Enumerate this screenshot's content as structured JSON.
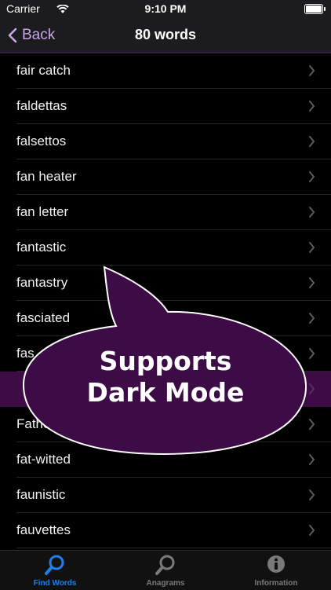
{
  "status": {
    "carrier": "Carrier",
    "time": "9:10 PM"
  },
  "nav": {
    "back_label": "Back",
    "title": "80 words"
  },
  "words": [
    "fair catch",
    "faldettas",
    "falsettos",
    "fan heater",
    "fan letter",
    "fantastic",
    "fantastry",
    "fasciated",
    "fas",
    "",
    "Father",
    "fat-witted",
    "faunistic",
    "fauvettes"
  ],
  "selected_index": 9,
  "overlay": {
    "line1": "Supports",
    "line2": "Dark Mode"
  },
  "tabs": [
    {
      "label": "Find Words",
      "icon": "magnifier-icon",
      "active": true
    },
    {
      "label": "Anagrams",
      "icon": "magnifier-icon",
      "active": false
    },
    {
      "label": "Information",
      "icon": "info-icon",
      "active": false
    }
  ],
  "colors": {
    "accent": "#1f7fe8",
    "selected_row": "#3d0b45",
    "bubble": "#3d0b45",
    "back": "#c9a6e6"
  }
}
